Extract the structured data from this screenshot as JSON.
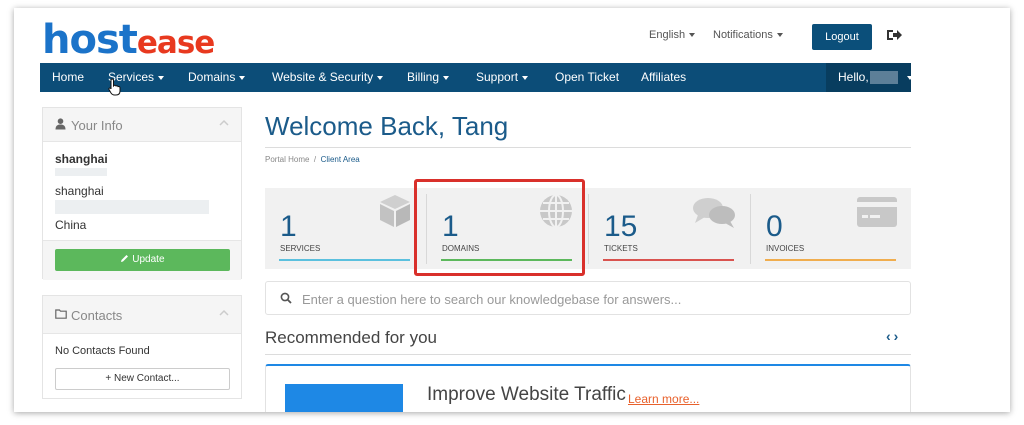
{
  "brand": {
    "logo_host": "host",
    "logo_ease": "ease",
    "host_color": "#1b73c9",
    "ease_color": "#e8391f"
  },
  "header": {
    "language": "English",
    "notifications": "Notifications",
    "logout": "Logout",
    "exit_icon": "sign-out-icon"
  },
  "nav": {
    "items": [
      {
        "label": "Home",
        "dropdown": false
      },
      {
        "label": "Services",
        "dropdown": true
      },
      {
        "label": "Domains",
        "dropdown": true
      },
      {
        "label": "Website & Security",
        "dropdown": true
      },
      {
        "label": "Billing",
        "dropdown": true
      },
      {
        "label": "Support",
        "dropdown": true
      },
      {
        "label": "Open Ticket",
        "dropdown": false
      },
      {
        "label": "Affiliates",
        "dropdown": false
      }
    ],
    "hello": "Hello,",
    "bar_color": "#0c4d78"
  },
  "sidebar": {
    "your_info": {
      "title": "Your Info",
      "lines": [
        "shanghai",
        "shanghai",
        "China"
      ],
      "update_button": "Update"
    },
    "contacts": {
      "title": "Contacts",
      "empty_text": "No Contacts Found",
      "new_contact_button": "+ New Contact..."
    }
  },
  "main": {
    "welcome": "Welcome Back, Tang",
    "breadcrumb": [
      "Portal Home",
      "Client Area"
    ],
    "tiles": [
      {
        "count": "1",
        "label": "SERVICES",
        "color": "#5bc0de",
        "icon": "box-icon"
      },
      {
        "count": "1",
        "label": "DOMAINS",
        "color": "#5cb85c",
        "icon": "globe-icon"
      },
      {
        "count": "15",
        "label": "TICKETS",
        "color": "#d9534f",
        "icon": "comments-icon"
      },
      {
        "count": "0",
        "label": "INVOICES",
        "color": "#f0ad4e",
        "icon": "credit-card-icon"
      }
    ],
    "kb_search_placeholder": "Enter a question here to search our knowledgebase for answers...",
    "recommended_title": "Recommended for you",
    "recommendation": {
      "title": "Improve Website Traffic",
      "link": "Learn more..."
    }
  }
}
